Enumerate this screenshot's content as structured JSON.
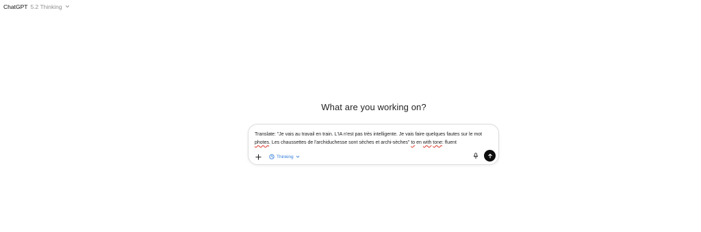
{
  "header": {
    "app_name": "ChatGPT",
    "model_version": "5.2 Thinking",
    "selector_icon": "chevron-down-icon"
  },
  "main": {
    "heading": "What are you working on?"
  },
  "composer": {
    "prompt": {
      "part1": "Translate: \"Je vais au travail en train. L'IA n'est pas très intelligente. Je vais faire quelques fautes sur le mot ",
      "word_photes": "photes",
      "part2": ". Les chaussettes de l'archiduchesse sont sèches et archi-sèches\" ",
      "word_to": "to",
      "part3": " en ",
      "word_with": "with",
      "part4": " ",
      "word_tone": "tone",
      "part5": ": fluent"
    },
    "add_icon": "plus-icon",
    "mode_label": "Thinking",
    "mode_icon": "clock-icon",
    "mic_icon": "microphone-icon",
    "send_icon": "arrow-up-icon",
    "accent_color": "#2f7ad8"
  }
}
